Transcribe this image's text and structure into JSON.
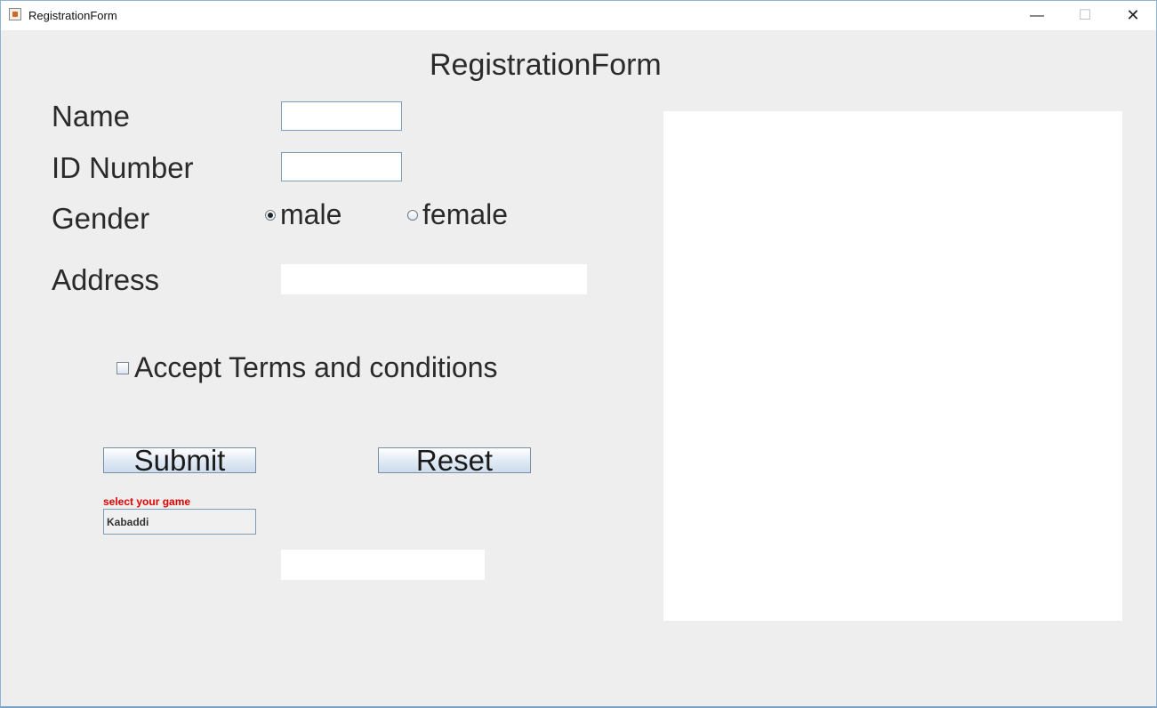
{
  "window": {
    "title": "RegistrationForm",
    "min_symbol": "—",
    "max_symbol": "☐",
    "close_symbol": "✕"
  },
  "form": {
    "heading": "RegistrationForm",
    "name_label": "Name",
    "id_label": "ID Number",
    "gender_label": "Gender",
    "gender_options": [
      {
        "label": "male",
        "selected": true
      },
      {
        "label": "female",
        "selected": false
      }
    ],
    "address_label": "Address",
    "terms_label": "Accept Terms and conditions",
    "terms_checked": false,
    "submit_label": "Submit",
    "reset_label": "Reset",
    "game_label": "select your game",
    "game_value": "Kabaddi"
  },
  "colors": {
    "accent_label": "#e00000",
    "background": "#eeeeee"
  }
}
